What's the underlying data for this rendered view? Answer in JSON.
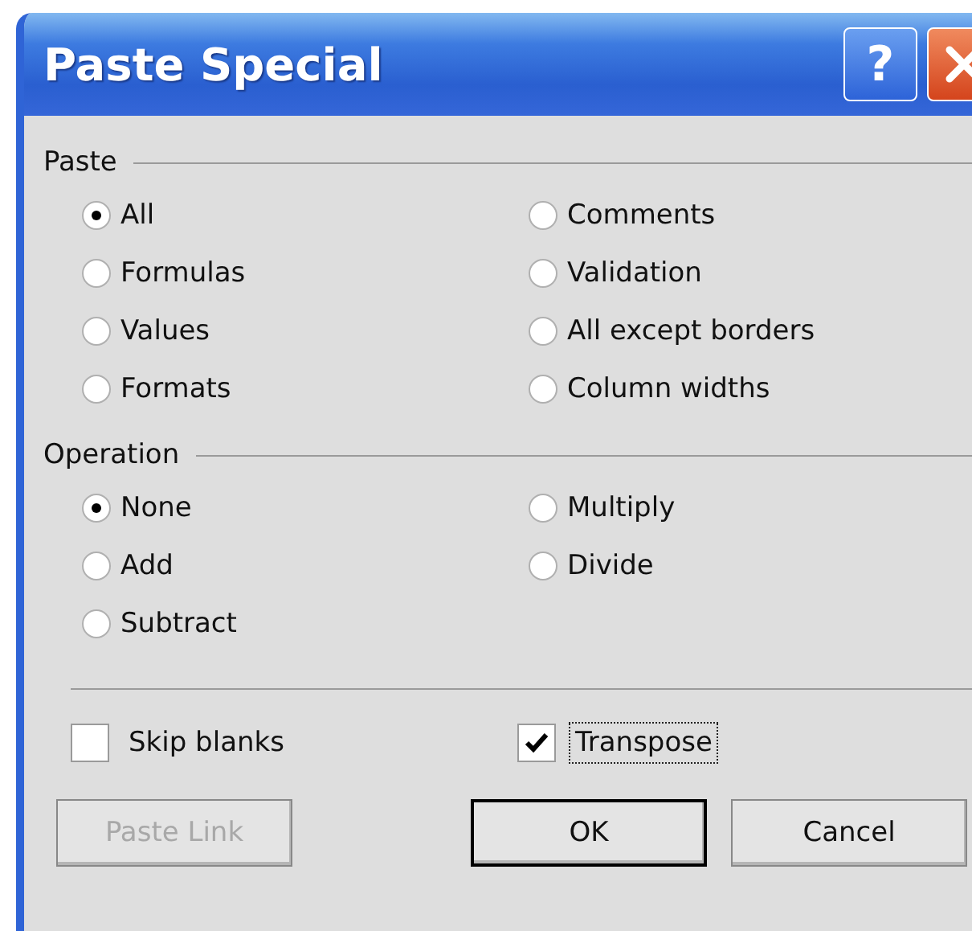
{
  "window": {
    "title": "Paste Special",
    "help_button": "?"
  },
  "paste": {
    "label": "Paste",
    "options": [
      {
        "label": "All",
        "selected": true
      },
      {
        "label": "Formulas",
        "selected": false
      },
      {
        "label": "Values",
        "selected": false
      },
      {
        "label": "Formats",
        "selected": false
      },
      {
        "label": "Comments",
        "selected": false
      },
      {
        "label": "Validation",
        "selected": false
      },
      {
        "label": "All except borders",
        "selected": false
      },
      {
        "label": "Column widths",
        "selected": false
      }
    ]
  },
  "operation": {
    "label": "Operation",
    "options": [
      {
        "label": "None",
        "selected": true
      },
      {
        "label": "Add",
        "selected": false
      },
      {
        "label": "Subtract",
        "selected": false
      },
      {
        "label": "Multiply",
        "selected": false
      },
      {
        "label": "Divide",
        "selected": false
      }
    ]
  },
  "checkboxes": [
    {
      "label": "Skip blanks",
      "checked": false,
      "focused": false
    },
    {
      "label": "Transpose",
      "checked": true,
      "focused": true
    }
  ],
  "buttons": [
    {
      "label": "Paste Link",
      "disabled": true,
      "default": false
    },
    {
      "label": "OK",
      "disabled": false,
      "default": true
    },
    {
      "label": "Cancel",
      "disabled": false,
      "default": false
    }
  ]
}
